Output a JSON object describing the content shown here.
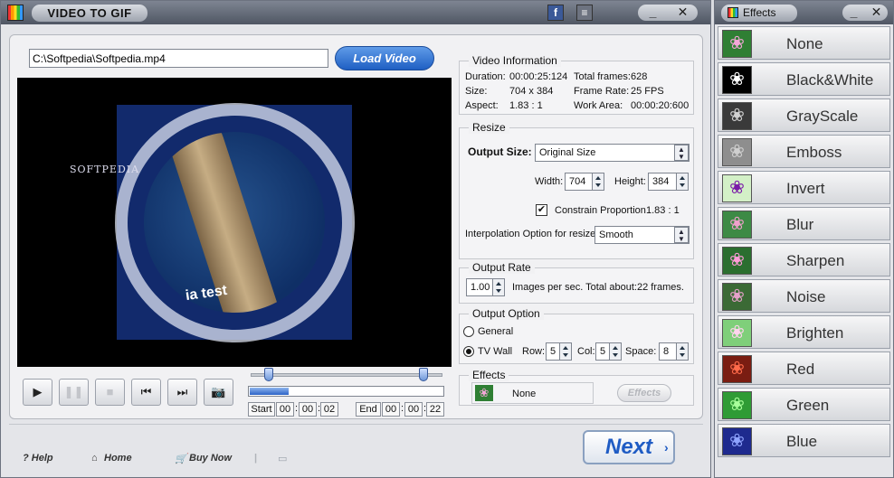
{
  "app": {
    "title": "VIDEO TO GIF",
    "minimize": "_",
    "close": "✕"
  },
  "source": {
    "path": "C:\\Softpedia\\Softpedia.mp4",
    "load_label": "Load Video"
  },
  "video_preview": {
    "watermark": "SOFTPEDIA",
    "overlay_text": "ia test"
  },
  "video_info": {
    "title": "Video Information",
    "duration_label": "Duration:",
    "duration": "00:00:25:124",
    "total_frames_label": "Total frames:",
    "total_frames": "628",
    "size_label": "Size:",
    "size": "704 x 384",
    "frame_rate_label": "Frame Rate:",
    "frame_rate": "25 FPS",
    "aspect_label": "Aspect:",
    "aspect": "1.83 : 1",
    "work_area_label": "Work Area:",
    "work_area": "00:00:20:600"
  },
  "resize": {
    "title": "Resize",
    "output_size_label": "Output Size:",
    "output_size": "Original Size",
    "width_label": "Width:",
    "width": "704",
    "height_label": "Height:",
    "height": "384",
    "constrain_label": "Constrain Proportion",
    "constrain_value": "1.83 : 1",
    "interp_label": "Interpolation Option for resize:",
    "interp": "Smooth"
  },
  "output_rate": {
    "title": "Output Rate",
    "value": "1.00",
    "text": "Images per sec. Total about:22 frames."
  },
  "output_option": {
    "title": "Output Option",
    "general": "General",
    "tv_wall": "TV Wall",
    "row_label": "Row:",
    "row": "5",
    "col_label": "Col:",
    "col": "5",
    "space_label": "Space:",
    "space": "8"
  },
  "effects_group": {
    "title": "Effects",
    "current": "None",
    "button": "Effects"
  },
  "timeline": {
    "start_label": "Start",
    "start": [
      "00",
      "00",
      "02"
    ],
    "end_label": "End",
    "end": [
      "00",
      "00",
      "22"
    ],
    "progress": 0.2
  },
  "controls": {
    "play": "▶",
    "pause": "❚❚",
    "stop": "■",
    "prev": "⏮",
    "next": "⏭",
    "snapshot": "📷"
  },
  "footer": {
    "help": "? Help",
    "home": "Home",
    "buy": "Buy Now",
    "next": "Next"
  },
  "effects_panel": {
    "title": "Effects",
    "items": [
      {
        "label": "None",
        "bg": "#2f7f34",
        "fg": "#f4a6d8"
      },
      {
        "label": "Black&White",
        "bg": "#000000",
        "fg": "#ffffff"
      },
      {
        "label": "GrayScale",
        "bg": "#3a3a3a",
        "fg": "#d0d0d0"
      },
      {
        "label": "Emboss",
        "bg": "#8e8e8e",
        "fg": "#cfcfcf"
      },
      {
        "label": "Invert",
        "bg": "#d3f0c7",
        "fg": "#7a1aa8"
      },
      {
        "label": "Blur",
        "bg": "#3d8a45",
        "fg": "#f0a0cc"
      },
      {
        "label": "Sharpen",
        "bg": "#2b6e2f",
        "fg": "#ff9bd7"
      },
      {
        "label": "Noise",
        "bg": "#3b6a35",
        "fg": "#e4a0c8"
      },
      {
        "label": "Brighten",
        "bg": "#7fcf7a",
        "fg": "#ffd4ee"
      },
      {
        "label": "Red",
        "bg": "#7a1d12",
        "fg": "#ff6a4a"
      },
      {
        "label": "Green",
        "bg": "#2f9b35",
        "fg": "#a8ff9a"
      },
      {
        "label": "Blue",
        "bg": "#1e2a8e",
        "fg": "#8fa4ff"
      }
    ]
  }
}
